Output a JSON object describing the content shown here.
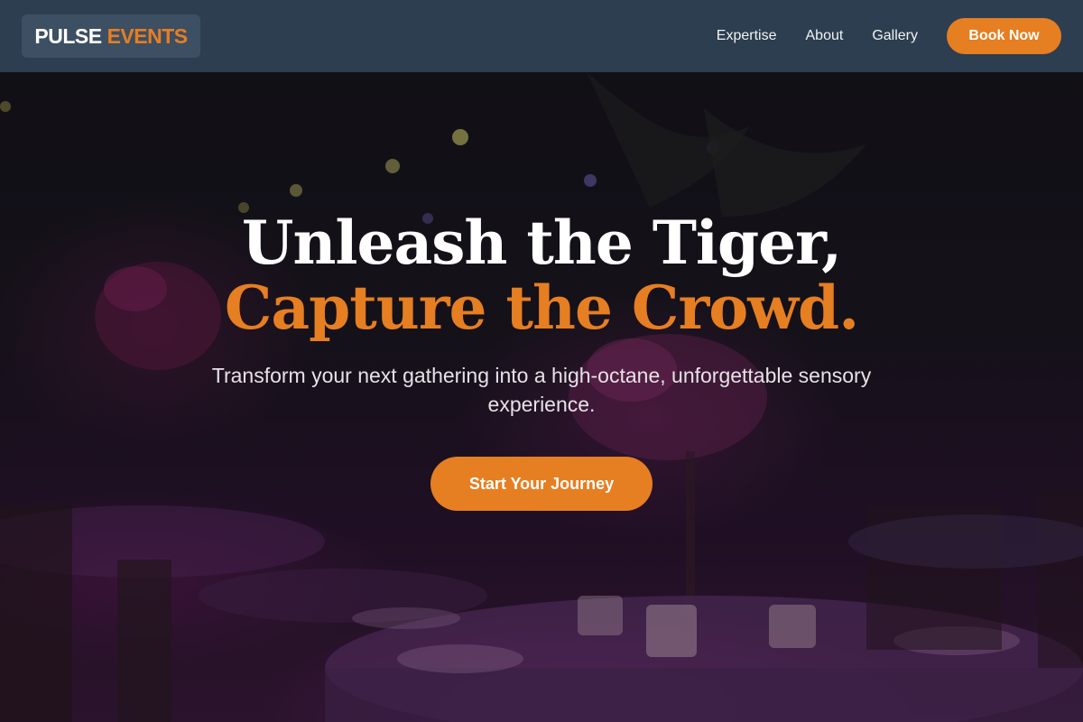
{
  "brand": {
    "name_part1": "PULSE",
    "name_part2": "EVENTS"
  },
  "nav": {
    "links": [
      "Expertise",
      "About",
      "Gallery"
    ],
    "cta_label": "Book Now"
  },
  "hero": {
    "headline_line1": "Unleash the Tiger,",
    "headline_line2": "Capture the Crowd.",
    "subtitle": "Transform your next gathering into a high-octane, unforgettable sensory experience.",
    "cta_label": "Start Your Journey",
    "background_image": "dim event venue with round dining tables, glassware, candles and pink floral centerpieces under purple lighting"
  },
  "colors": {
    "accent": "#e67e22",
    "navbar": "#2c3e50",
    "logo_box": "#3d4f62"
  }
}
